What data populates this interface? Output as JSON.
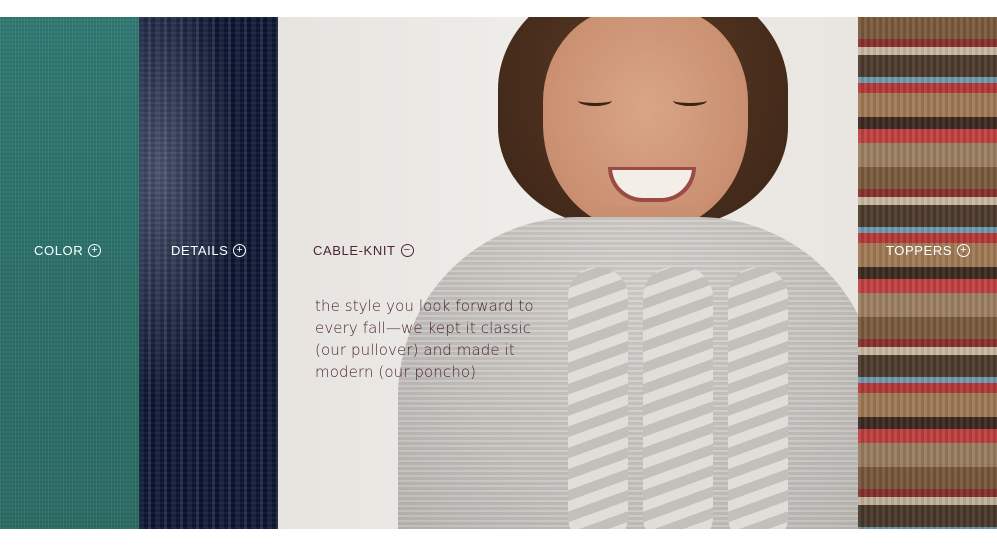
{
  "panels": [
    {
      "label": "COLOR",
      "icon": "plus-circle-icon",
      "state": "collapsed",
      "swatch": "#2e766e"
    },
    {
      "label": "DETAILS",
      "icon": "plus-circle-icon",
      "state": "collapsed",
      "swatch": "#141d36"
    },
    {
      "label": "CABLE-KNIT",
      "icon": "minus-circle-icon",
      "state": "expanded",
      "swatch": "#d3d0cc",
      "description": "the style you look forward to every fall—we kept it classic (our pullover) and made it modern (our poncho)"
    },
    {
      "label": "TOPPERS",
      "icon": "plus-circle-icon",
      "state": "collapsed",
      "swatch": "#8a3030"
    }
  ],
  "colors": {
    "label_light": "#ffffff",
    "label_dark": "#4a2533",
    "background": "#ffffff"
  }
}
